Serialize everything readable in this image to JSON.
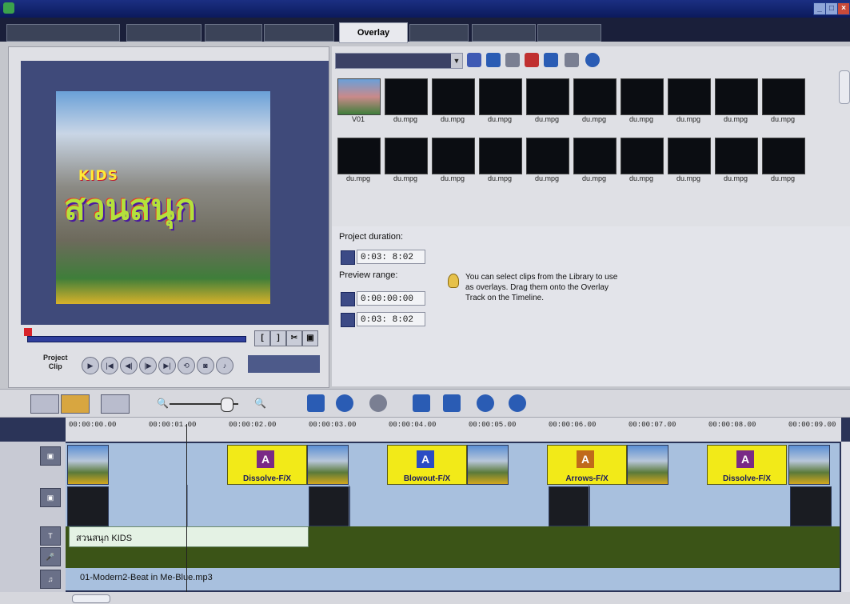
{
  "tabs": [
    {
      "label": "",
      "active": false
    },
    {
      "label": "",
      "active": false
    },
    {
      "label": "",
      "active": false
    },
    {
      "label": "",
      "active": false
    },
    {
      "label": "Overlay",
      "active": true
    },
    {
      "label": "",
      "active": false
    },
    {
      "label": "",
      "active": false
    },
    {
      "label": "",
      "active": false
    }
  ],
  "preview": {
    "kids_text": "KIDS",
    "thai_title": "สวนสนุก",
    "mode_label_top": "Project",
    "mode_label_bottom": "Clip",
    "timecode": ""
  },
  "library": {
    "dropdown_value": "",
    "thumbnails_row1": [
      "V01",
      "du.mpg",
      "du.mpg",
      "du.mpg",
      "du.mpg",
      "du.mpg",
      "du.mpg",
      "du.mpg",
      "du.mpg",
      "du.mpg"
    ],
    "thumbnails_row2": [
      "du.mpg",
      "du.mpg",
      "du.mpg",
      "du.mpg",
      "du.mpg",
      "du.mpg",
      "du.mpg",
      "du.mpg",
      "du.mpg",
      "du.mpg"
    ]
  },
  "options": {
    "project_duration_label": "Project duration:",
    "project_duration_value": "0:03: 8:02",
    "preview_range_label": "Preview range:",
    "preview_start": "0:00:00:00",
    "preview_end": "0:03: 8:02",
    "tip_text": "You can select clips from the Library to use as overlays. Drag them onto the Overlay Track on the Timeline."
  },
  "timeline": {
    "ruler_ticks": [
      "00:00:00.00",
      "00:00:01.00",
      "00:00:02.00",
      "00:00:03.00",
      "00:00:04.00",
      "00:00:05.00",
      "00:00:06.00",
      "00:00:07.00",
      "00:00:08.00",
      "00:00:09.00"
    ],
    "transitions": [
      "Dissolve-F/X",
      "Blowout-F/X",
      "Arrows-F/X",
      "Dissolve-F/X"
    ],
    "title_clip": "สวนสนุก KIDS",
    "music_clip": "01-Modern2-Beat in Me-Blue.mp3"
  },
  "colors": {
    "title_bar": "#0b1a5c",
    "transition_yellow": "#f2ea18",
    "track_blue": "#a8c0de",
    "track_green": "#3b5417"
  },
  "icons": [
    "app-icon",
    "minimize-icon",
    "maximize-icon",
    "close-icon",
    "folder-icon",
    "import-icon",
    "options-icon",
    "capture-icon",
    "sort-icon",
    "info-icon",
    "lightbulb-icon",
    "play-icon",
    "stop-icon",
    "zoom-in-icon",
    "zoom-out-icon"
  ]
}
